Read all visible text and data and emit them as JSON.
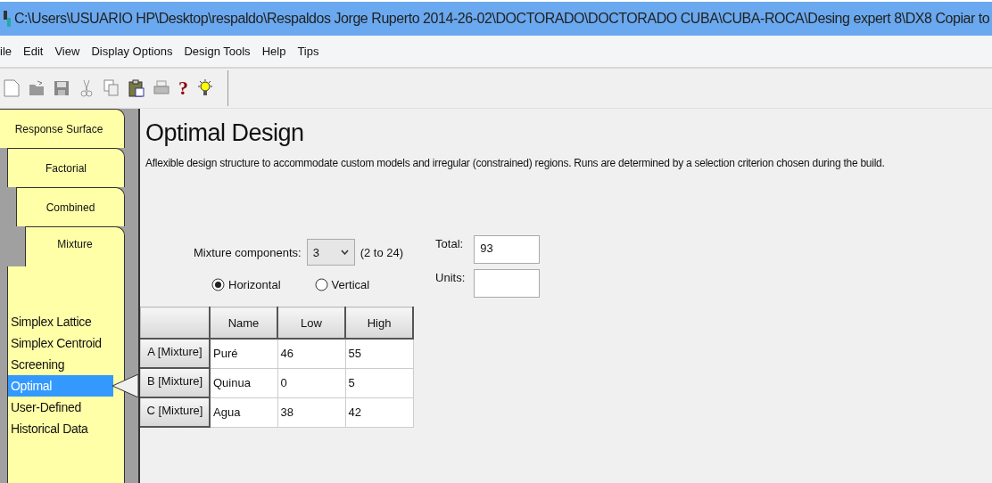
{
  "window": {
    "title": "C:\\Users\\USUARIO HP\\Desktop\\respaldo\\Respaldos Jorge Ruperto 2014-26-02\\DOCTORADO\\DOCTORADO CUBA\\CUBA-ROCA\\Desing expert 8\\DX8 Copiar to"
  },
  "menu": [
    "ile",
    "Edit",
    "View",
    "Display Options",
    "Design Tools",
    "Help",
    "Tips"
  ],
  "toolbar": {
    "help_label": "?"
  },
  "design_tabs": [
    {
      "label": "Response Surface",
      "selected": false
    },
    {
      "label": "Factorial",
      "selected": false
    },
    {
      "label": "Combined",
      "selected": false
    },
    {
      "label": "Mixture",
      "selected": true
    }
  ],
  "design_types": [
    {
      "label": "Simplex Lattice",
      "selected": false
    },
    {
      "label": "Simplex Centroid",
      "selected": false
    },
    {
      "label": "Screening",
      "selected": false
    },
    {
      "label": "Optimal",
      "selected": true
    },
    {
      "label": "User-Defined",
      "selected": false
    },
    {
      "label": "Historical Data",
      "selected": false
    }
  ],
  "content": {
    "heading": "Optimal Design",
    "description": "Aflexible design structure to accommodate custom models and irregular (constrained) regions.  Runs are determined by a selection criterion chosen during the build.",
    "mixture_components": {
      "label": "Mixture components:",
      "value": "3",
      "range": "(2 to 24)"
    },
    "orientation": [
      {
        "label": "Horizontal",
        "selected": true
      },
      {
        "label": "Vertical",
        "selected": false
      }
    ],
    "total": {
      "label": "Total:",
      "value": "93"
    },
    "units": {
      "label": "Units:"
    },
    "table": {
      "columns": [
        "Name",
        "Low",
        "High"
      ],
      "rows": [
        {
          "header": "A [Mixture]",
          "name": "Puré",
          "low": "46",
          "high": "55"
        },
        {
          "header": "B [Mixture]",
          "name": "Quinua",
          "low": "0",
          "high": "5"
        },
        {
          "header": "C [Mixture]",
          "name": "Agua",
          "low": "38",
          "high": "42"
        }
      ]
    }
  }
}
